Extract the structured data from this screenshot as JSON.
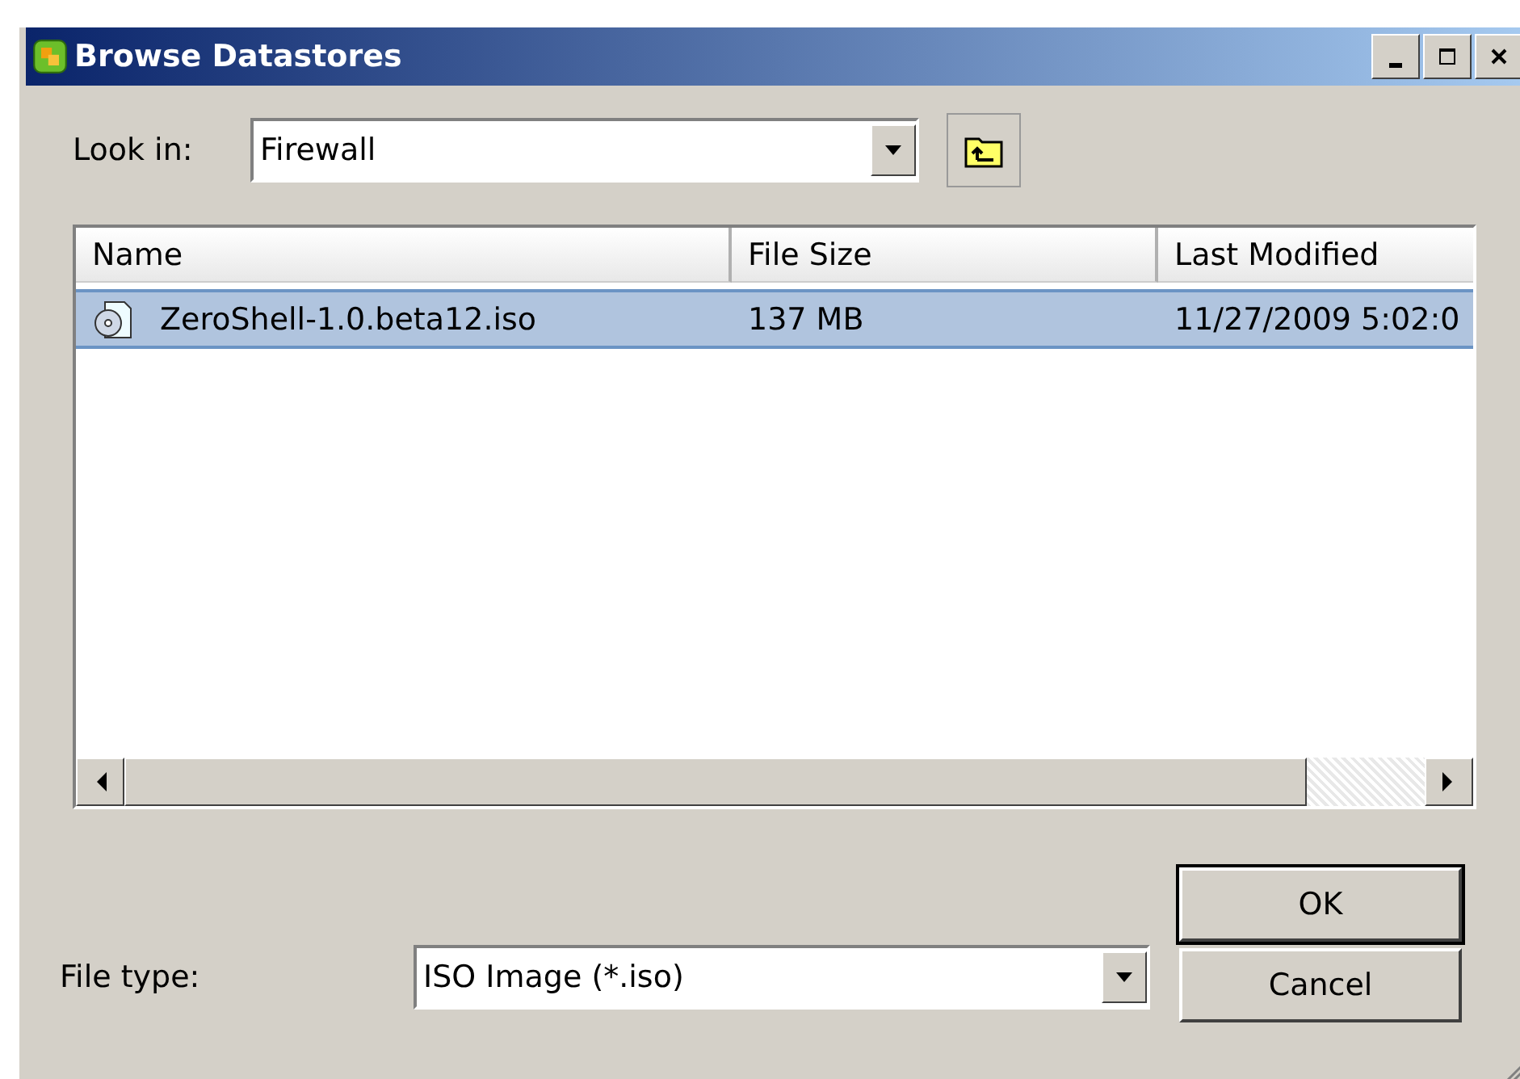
{
  "window": {
    "title": "Browse Datastores"
  },
  "look_in": {
    "label": "Look in:",
    "value": "Firewall"
  },
  "table": {
    "columns": [
      "Name",
      "File Size",
      "Last Modified"
    ],
    "rows": [
      {
        "name": "ZeroShell-1.0.beta12.iso",
        "size": "137 MB",
        "modified": "11/27/2009 5:02:0",
        "selected": true
      }
    ]
  },
  "file_type": {
    "label": "File type:",
    "value": "ISO Image (*.iso)"
  },
  "buttons": [
    {
      "label": "OK",
      "default": true
    },
    {
      "label": "Cancel",
      "default": false
    }
  ]
}
